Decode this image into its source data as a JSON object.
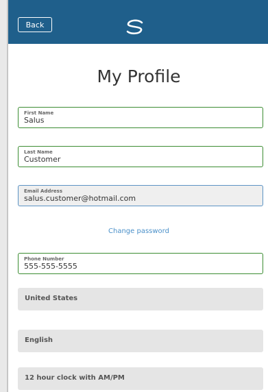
{
  "header": {
    "back_label": "Back",
    "logo_icon": "swirl-logo-icon",
    "background": "#1f5f8b"
  },
  "page": {
    "title": "My Profile"
  },
  "fields": {
    "first_name": {
      "label": "First Name",
      "value": "Salus"
    },
    "last_name": {
      "label": "Last Name",
      "value": "Customer"
    },
    "email": {
      "label": "Email Address",
      "value": "salus.customer@hotmail.com"
    },
    "phone": {
      "label": "Phone Number",
      "value": "555-555-5555"
    }
  },
  "links": {
    "change_password": "Change password"
  },
  "selects": {
    "country": "United States",
    "language": "English",
    "clock": "12 hour clock with AM/PM"
  },
  "colors": {
    "field_border": "#3b8c31",
    "email_border": "#5b93c4",
    "link": "#4a90c9"
  }
}
